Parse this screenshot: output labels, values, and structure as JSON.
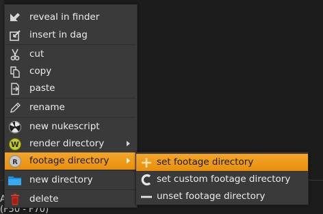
{
  "background": {
    "text_line_1": "AC",
    "text_line_2": "(F50 - F70)"
  },
  "context_menu": {
    "items": [
      {
        "label": "reveal in finder",
        "icon": "reveal-arrow-icon"
      },
      {
        "label": "insert in dag",
        "icon": "insert-square-icon"
      },
      {
        "label": "cut",
        "icon": "scissors-icon"
      },
      {
        "label": "copy",
        "icon": "copy-pages-icon"
      },
      {
        "label": "paste",
        "icon": "paste-arrow-icon"
      },
      {
        "label": "rename",
        "icon": "pencil-icon"
      },
      {
        "label": "new nukescript",
        "icon": "nuke-logo-icon"
      },
      {
        "label": "render directory",
        "icon": "w-badge-icon"
      },
      {
        "label": "footage directory",
        "icon": "r-badge-icon"
      },
      {
        "label": "new directory",
        "icon": "folder-icon"
      },
      {
        "label": "delete",
        "icon": "trash-icon"
      }
    ],
    "highlighted": "footage directory"
  },
  "submenu": {
    "items": [
      {
        "label": "set footage directory",
        "icon": "plus-icon"
      },
      {
        "label": "set custom footage directory",
        "icon": "c-icon"
      },
      {
        "label": "unset footage directory",
        "icon": "minus-icon"
      }
    ],
    "highlighted": "set footage directory"
  },
  "colors": {
    "highlight": "#f0a020",
    "menu_bg": "#3a3a3a",
    "text": "#ececec"
  }
}
